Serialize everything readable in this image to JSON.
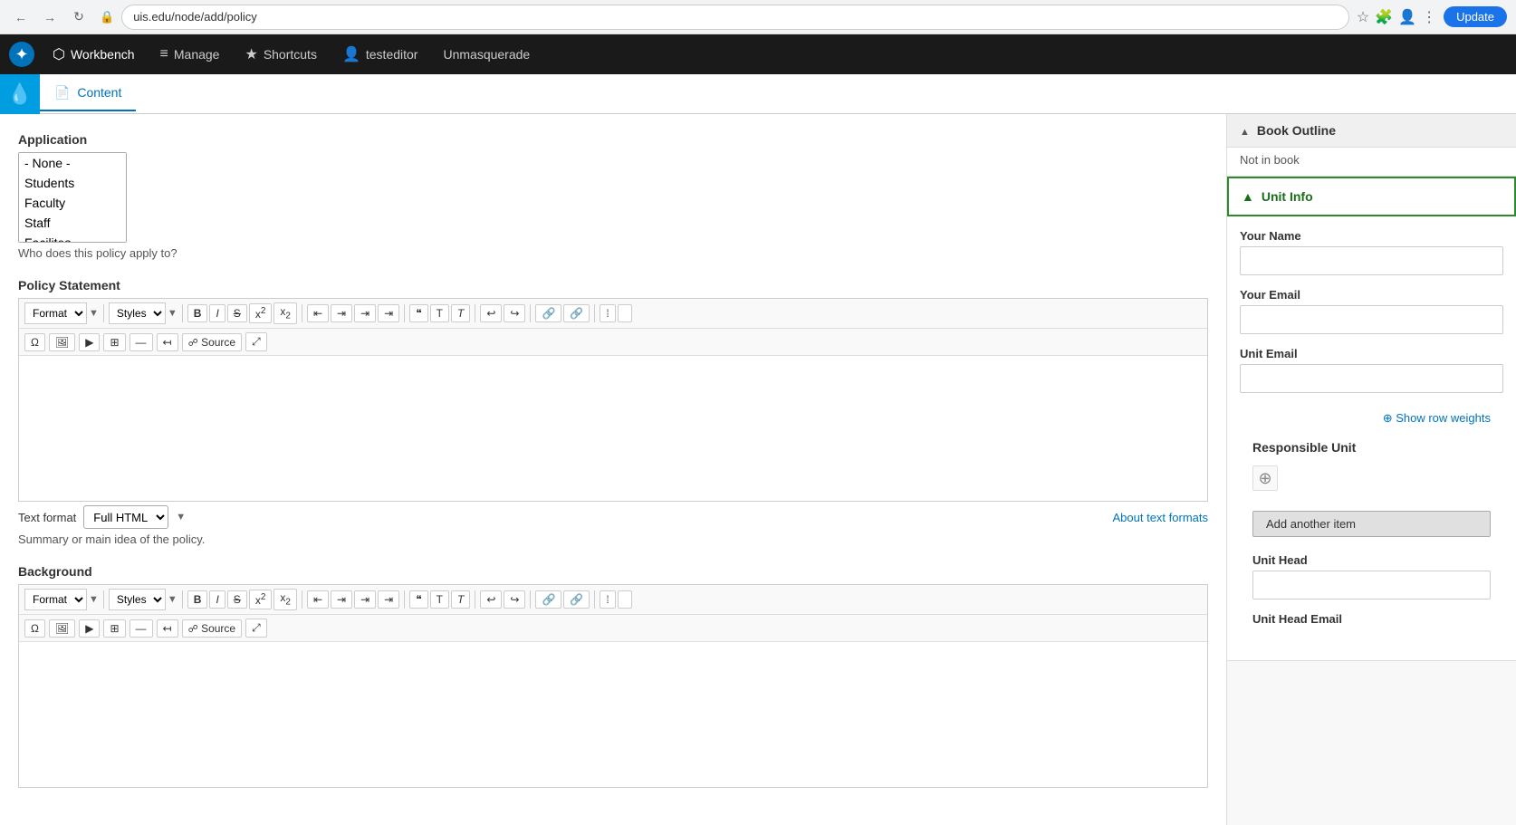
{
  "browser": {
    "url": "uis.edu/node/add/policy",
    "update_btn": "Update"
  },
  "admin_nav": {
    "workbench": "Workbench",
    "manage": "Manage",
    "shortcuts": "Shortcuts",
    "user": "testeditor",
    "unmasquerade": "Unmasquerade"
  },
  "secondary_nav": {
    "content_tab": "Content"
  },
  "form": {
    "application_label": "Application",
    "application_hint": "Who does this policy apply to?",
    "application_options": [
      "- None -",
      "Students",
      "Faculty",
      "Staff",
      "Facilites"
    ],
    "policy_statement_label": "Policy Statement",
    "policy_statement_hint": "Summary or main idea of the policy.",
    "background_label": "Background",
    "text_format_label": "Text format",
    "text_format_value": "Full HTML",
    "about_text_formats": "About text formats",
    "format_label": "Format",
    "styles_label": "Styles",
    "source_label": "Source"
  },
  "sidebar": {
    "book_outline_label": "Book Outline",
    "not_in_book": "Not in book",
    "unit_info_label": "Unit Info",
    "your_name_label": "Your Name",
    "your_email_label": "Your Email",
    "unit_email_label": "Unit Email",
    "show_row_weights": "Show row weights",
    "responsible_unit_label": "Responsible Unit",
    "add_another_item": "Add another item",
    "unit_head_label": "Unit Head",
    "unit_head_email_label": "Unit Head Email"
  },
  "toolbar_buttons": {
    "bold": "B",
    "italic": "I",
    "strikethrough": "S",
    "superscript": "x²",
    "subscript": "x₂",
    "align_left": "≡",
    "align_center": "≡",
    "align_right": "≡",
    "align_justify": "≡",
    "blockquote": "❝",
    "undo": "↩",
    "redo": "↪",
    "link": "🔗",
    "unlink": "🔗",
    "list_unordered": "≡",
    "list_ordered": "≡"
  }
}
